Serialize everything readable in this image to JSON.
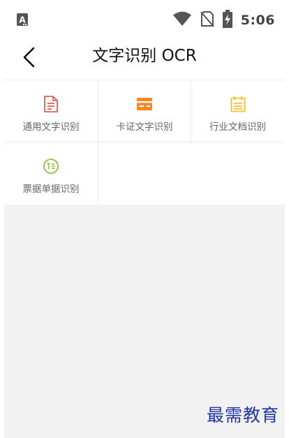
{
  "status_bar": {
    "time": "5:06",
    "icons": [
      "notification-a-icon",
      "wifi-icon",
      "no-sim-icon",
      "battery-charging-icon"
    ]
  },
  "header": {
    "title": "文字识别 OCR",
    "back_icon": "chevron-left-icon"
  },
  "grid": {
    "items": [
      {
        "label": "通用文字识别",
        "icon": "document-icon",
        "color": "#E06157"
      },
      {
        "label": "卡证文字识别",
        "icon": "card-icon",
        "color": "#F08A2A"
      },
      {
        "label": "行业文档识别",
        "icon": "calendar-list-icon",
        "color": "#F2C12E"
      },
      {
        "label": "票据单据识别",
        "icon": "receipt-circle-icon",
        "color": "#8CC63F"
      }
    ]
  },
  "watermark": {
    "text": "最需教育",
    "color": "#1E35A8"
  }
}
